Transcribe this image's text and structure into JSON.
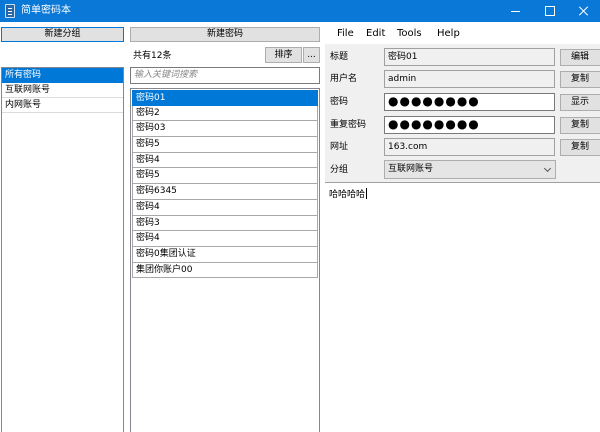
{
  "window": {
    "title": "简单密码本"
  },
  "left_panel": {
    "new_group_label": "新建分组",
    "groups": [
      "所有密码",
      "互联网账号",
      "内网账号"
    ]
  },
  "middle_panel": {
    "new_password_label": "新建密码",
    "count_label": "共有12条",
    "sort_label": "排序",
    "more_label": "...",
    "search_placeholder": "输入关键词搜索",
    "items": [
      "密码01",
      "密码2",
      "密码03",
      "密码5",
      "密码4",
      "密码5",
      "密码6345",
      "密码4",
      "密码3",
      "密码4",
      "密码0集团认证",
      "集团你账户00"
    ]
  },
  "menu": {
    "items": [
      "File",
      "Edit",
      "Tools",
      "Help"
    ]
  },
  "detail": {
    "title_label": "标题",
    "title_value": "密码01",
    "title_button": "编辑",
    "username_label": "用户名",
    "username_value": "admin",
    "username_button": "复制",
    "password_label": "密码",
    "password_value": "●●●●●●●●",
    "password_button": "显示",
    "repeat_label": "重复密码",
    "repeat_value": "●●●●●●●●",
    "repeat_button": "复制",
    "url_label": "网址",
    "url_value": "163.com",
    "url_button": "复制",
    "group_label": "分组",
    "group_value": "互联网账号",
    "notes": "哈哈哈哈"
  }
}
